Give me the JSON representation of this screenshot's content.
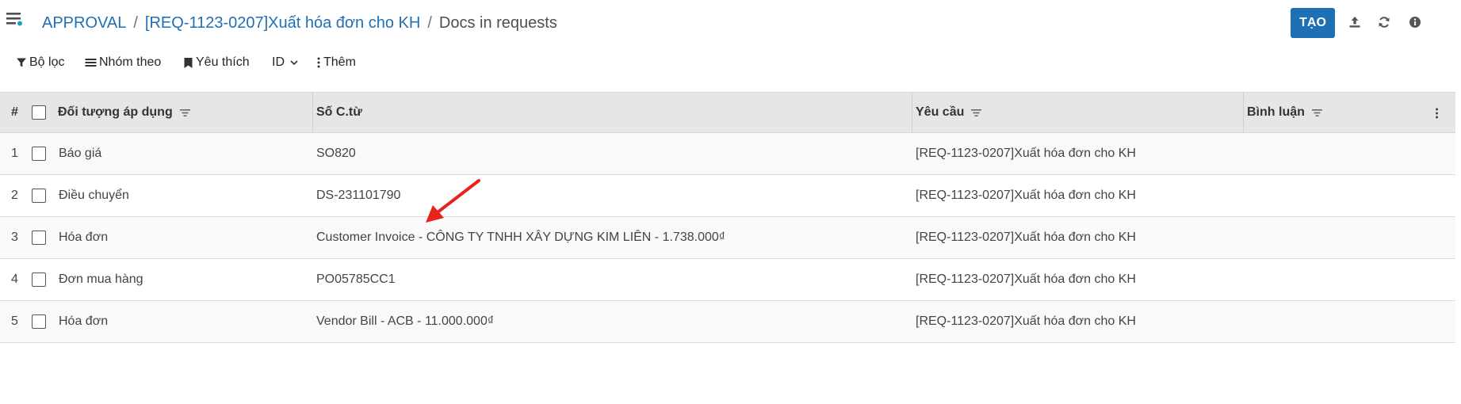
{
  "breadcrumb": {
    "root": "APPROVAL",
    "request": "[REQ-1123-0207]Xuất hóa đơn cho KH",
    "current": "Docs in requests",
    "separator": "/"
  },
  "toolbar": {
    "create_label": "TẠO",
    "icons": [
      "upload-icon",
      "refresh-icon",
      "info-icon"
    ],
    "accent_color": "#1f6fb5"
  },
  "searchbar": {
    "filter_label": "Bộ lọc",
    "group_label": "Nhóm theo",
    "favorite_label": "Yêu thích",
    "id_label": "ID",
    "more_label": "Thêm"
  },
  "table": {
    "columns": {
      "index": "#",
      "object": "Đối tượng áp dụng",
      "doc_no": "Số C.từ",
      "request": "Yêu cầu",
      "comment": "Bình luận"
    },
    "rows": [
      {
        "index": "1",
        "object": "Báo giá",
        "doc_no": "SO820",
        "request": "[REQ-1123-0207]Xuất hóa đơn cho KH",
        "comment": ""
      },
      {
        "index": "2",
        "object": "Điều chuyển",
        "doc_no": "DS-231101790",
        "request": "[REQ-1123-0207]Xuất hóa đơn cho KH",
        "comment": ""
      },
      {
        "index": "3",
        "object": "Hóa đơn",
        "doc_no": "Customer Invoice - CÔNG TY TNHH XÂY DỰNG KIM LIÊN - 1.738.000₫",
        "request": "[REQ-1123-0207]Xuất hóa đơn cho KH",
        "comment": ""
      },
      {
        "index": "4",
        "object": "Đơn mua hàng",
        "doc_no": "PO05785CC1",
        "request": "[REQ-1123-0207]Xuất hóa đơn cho KH",
        "comment": ""
      },
      {
        "index": "5",
        "object": "Hóa đơn",
        "doc_no": "Vendor Bill - ACB - 11.000.000₫",
        "request": "[REQ-1123-0207]Xuất hóa đơn cho KH",
        "comment": ""
      }
    ]
  },
  "annotation": {
    "arrow_color": "#e8231e"
  }
}
